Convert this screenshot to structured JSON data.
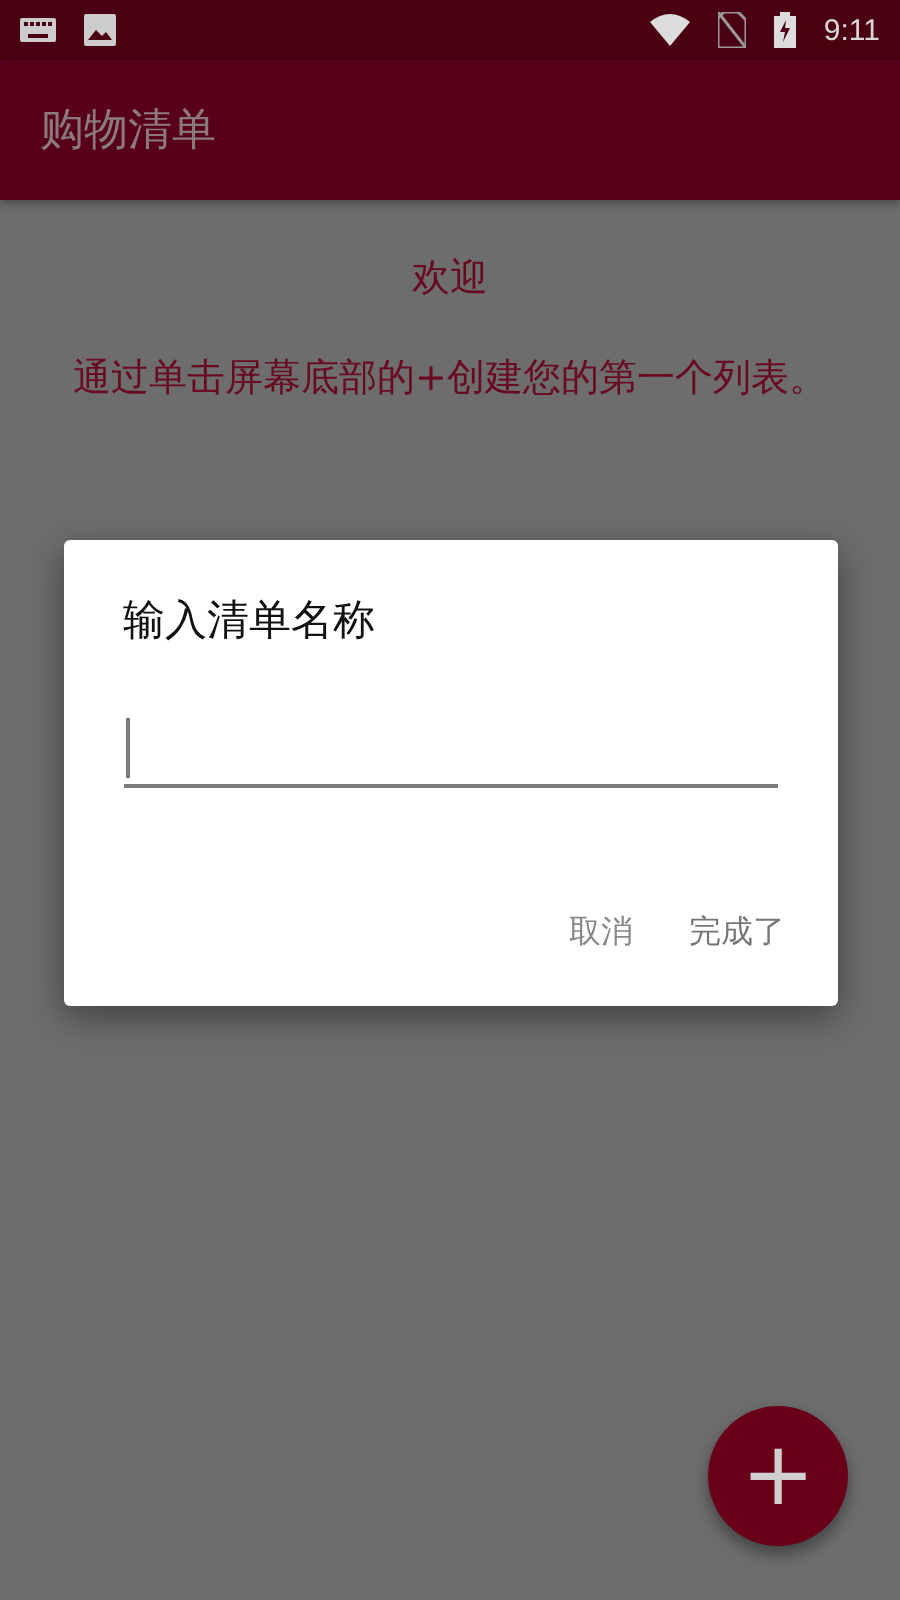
{
  "status_bar": {
    "time": "9:11"
  },
  "app_bar": {
    "title": "购物清单"
  },
  "welcome": {
    "title": "欢迎",
    "message": "通过单击屏幕底部的+创建您的第一个列表。"
  },
  "dialog": {
    "title": "输入清单名称",
    "field": {
      "focused": true
    },
    "buttons": [
      {
        "label": "取消",
        "kind": "cancel"
      },
      {
        "label": "完成了",
        "kind": "confirm"
      }
    ]
  },
  "fab": {
    "label": "+"
  }
}
